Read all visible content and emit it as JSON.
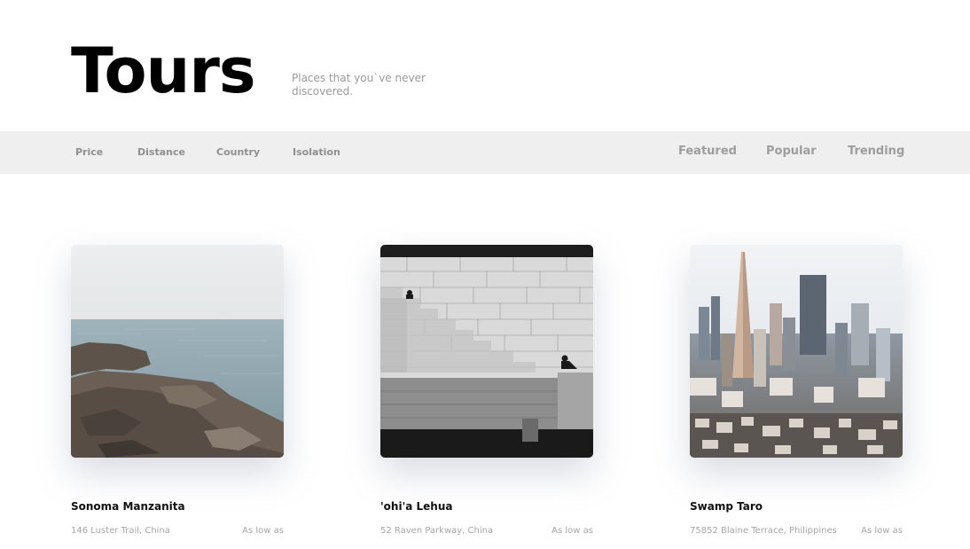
{
  "header": {
    "title": "Tours",
    "subtitle": "Places that you`ve never discovered."
  },
  "filters": [
    "Price",
    "Distance",
    "Country",
    "Isolation"
  ],
  "sort_tabs": [
    "Featured",
    "Popular",
    "Trending"
  ],
  "cards": [
    {
      "image": "rocky-seashore-photo",
      "name": "Sonoma Manzanita",
      "address": "146 Luster Trail, China",
      "price_label": "As low as"
    },
    {
      "image": "stone-stairs-wall-photo",
      "name": "'ohi'a Lehua",
      "address": "52 Raven Parkway, China",
      "price_label": "As low as"
    },
    {
      "image": "city-skyline-photo",
      "name": "Swamp Taro",
      "address": "75852 Blaine Terrace, Philippines",
      "price_label": "As low as"
    }
  ],
  "colors": {
    "filter_bar_bg": "#efefef",
    "filter_text": "#8f8f8f",
    "muted_text": "#a6a6a6",
    "title": "#000000"
  }
}
